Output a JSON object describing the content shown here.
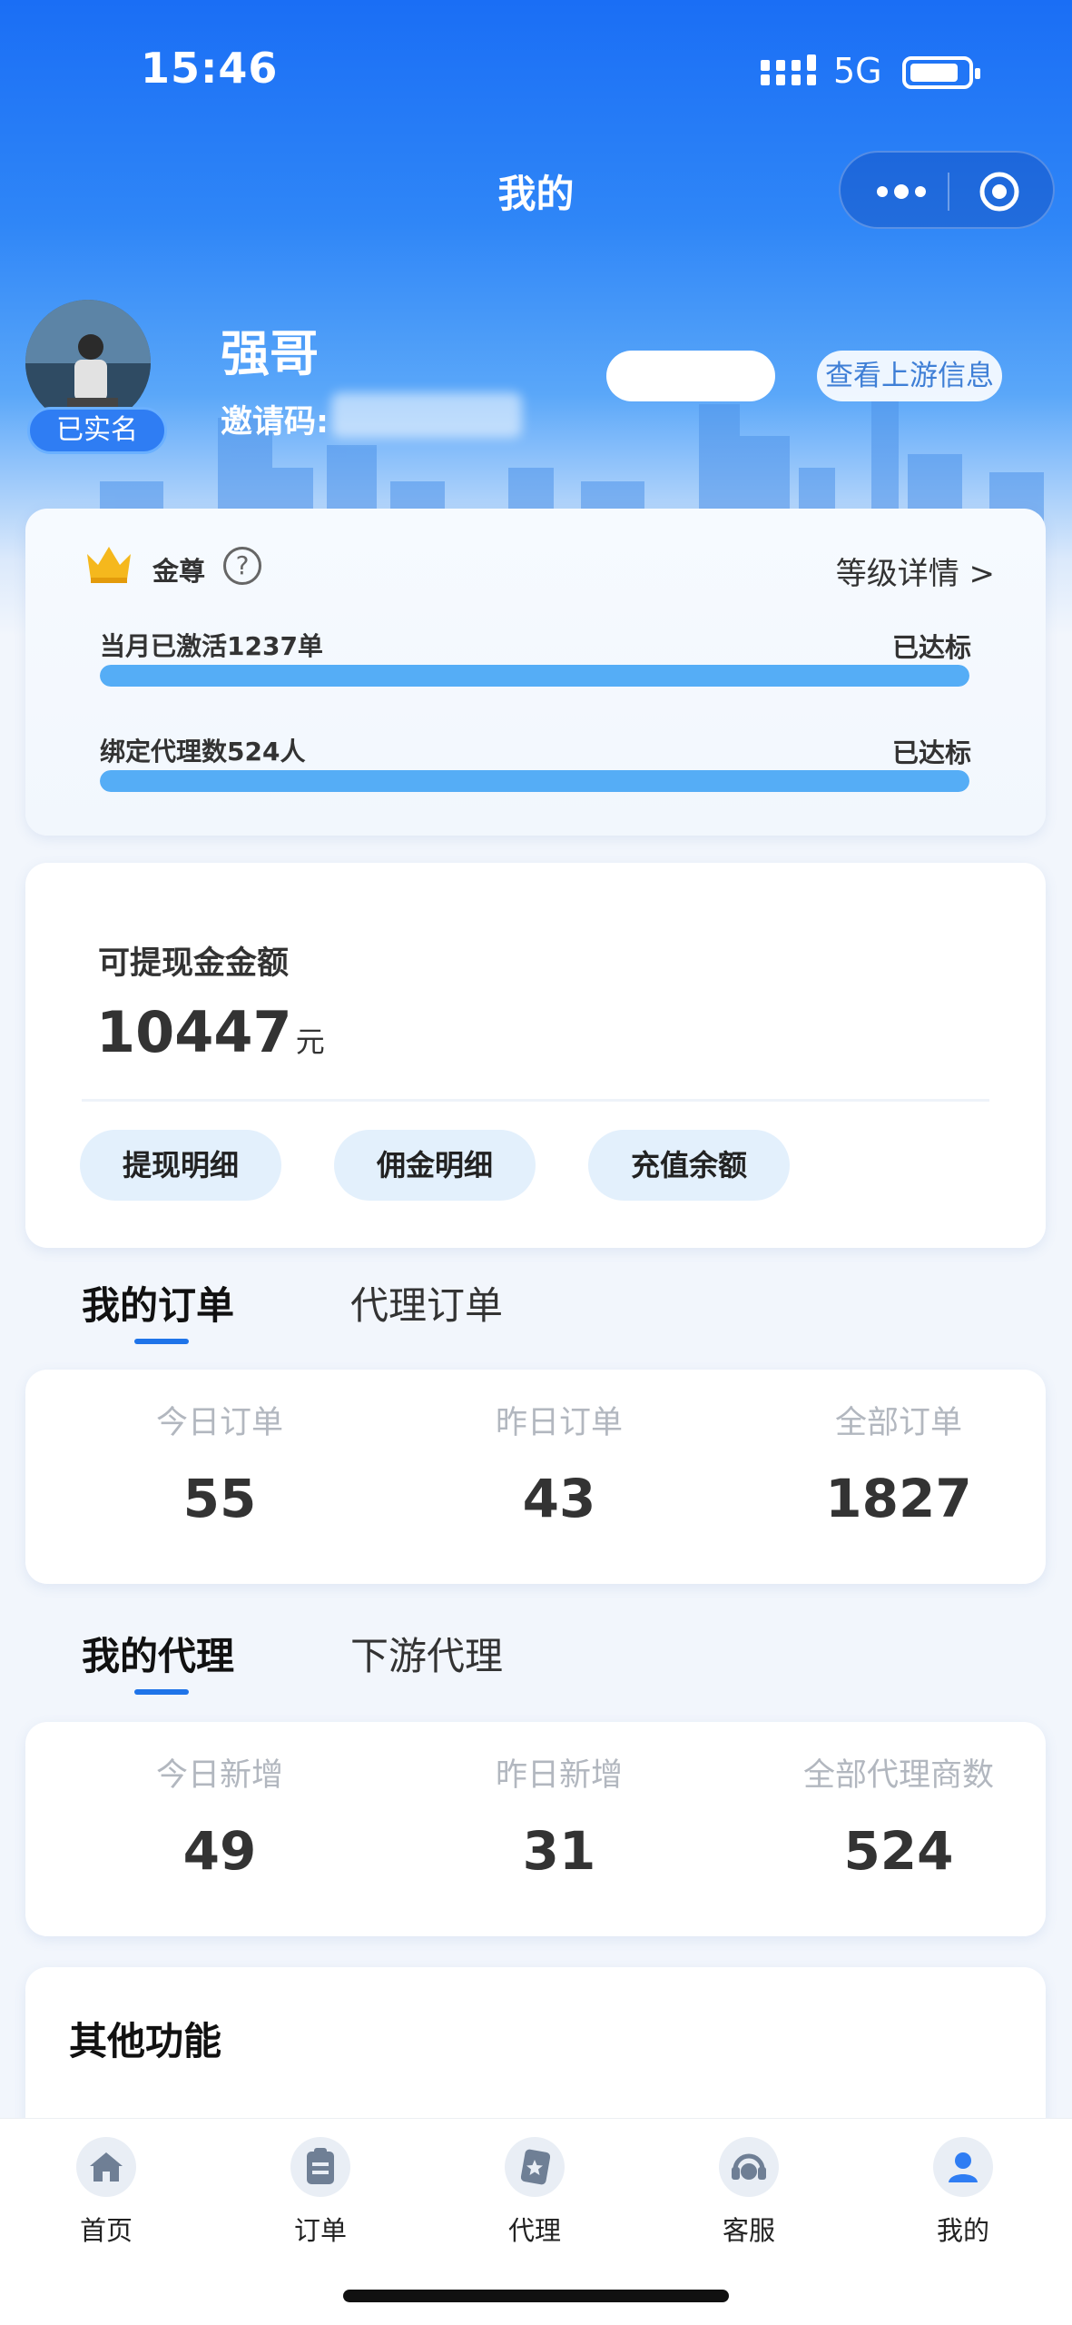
{
  "status_bar": {
    "time": "15:46",
    "network": "5G"
  },
  "nav": {
    "title": "我的"
  },
  "profile": {
    "name": "强哥",
    "verified_badge": "已实名",
    "invite_label": "邀请码:",
    "upstream_button": "查看上游信息"
  },
  "level": {
    "name": "金尊",
    "help_symbol": "?",
    "detail_link": "等级详情 >",
    "requirements": [
      {
        "label": "当月已激活1237单",
        "status": "已达标",
        "progress": 1.0
      },
      {
        "label": "绑定代理数524人",
        "status": "已达标",
        "progress": 1.0
      }
    ]
  },
  "balance": {
    "label": "可提现金金额",
    "amount": "10447",
    "unit": "元",
    "actions": [
      "提现明细",
      "佣金明细",
      "充值余额"
    ]
  },
  "orders": {
    "tabs": [
      "我的订单",
      "代理订单"
    ],
    "stats": [
      {
        "label": "今日订单",
        "value": "55"
      },
      {
        "label": "昨日订单",
        "value": "43"
      },
      {
        "label": "全部订单",
        "value": "1827"
      }
    ]
  },
  "agents": {
    "tabs": [
      "我的代理",
      "下游代理"
    ],
    "stats": [
      {
        "label": "今日新增",
        "value": "49"
      },
      {
        "label": "昨日新增",
        "value": "31"
      },
      {
        "label": "全部代理商数",
        "value": "524"
      }
    ]
  },
  "other": {
    "title": "其他功能"
  },
  "tabbar": {
    "items": [
      {
        "label": "首页",
        "icon": "home-icon"
      },
      {
        "label": "订单",
        "icon": "clipboard-icon"
      },
      {
        "label": "代理",
        "icon": "star-card-icon"
      },
      {
        "label": "客服",
        "icon": "headset-icon"
      },
      {
        "label": "我的",
        "icon": "user-icon"
      }
    ],
    "active_index": 4,
    "active_color": "#2f7df3"
  }
}
